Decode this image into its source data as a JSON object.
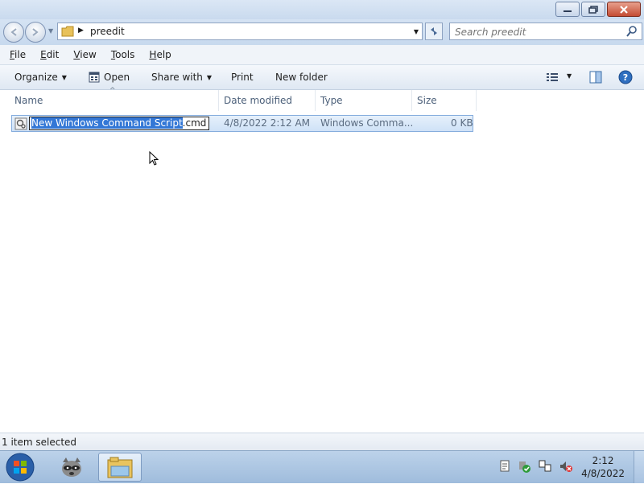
{
  "window": {
    "title": "",
    "minimize_label": "minimize",
    "restore_label": "restore",
    "close_label": "close"
  },
  "address": {
    "current_folder": "preedit",
    "search_placeholder": "Search preedit"
  },
  "menu": [
    {
      "key": "F",
      "rest": "ile"
    },
    {
      "key": "E",
      "rest": "dit"
    },
    {
      "key": "V",
      "rest": "iew"
    },
    {
      "key": "T",
      "rest": "ools"
    },
    {
      "key": "H",
      "rest": "elp"
    }
  ],
  "commands": {
    "organize": "Organize",
    "open": "Open",
    "share_with": "Share with",
    "print": "Print",
    "new_folder": "New folder"
  },
  "columns": {
    "name": "Name",
    "date_modified": "Date modified",
    "type": "Type",
    "size": "Size"
  },
  "file": {
    "rename_selected": "New Windows Command Script",
    "rename_extension": ".cmd",
    "date_modified": "4/8/2022 2:12 AM",
    "type": "Windows Comma...",
    "size": "0 KB"
  },
  "status": {
    "text": "1 item selected"
  },
  "taskbar": {
    "time": "2:12",
    "date": "4/8/2022"
  },
  "colors": {
    "selection": "#3377d6",
    "row_highlight": "#cfe2f7",
    "taskbar": "#9fbcdc"
  }
}
